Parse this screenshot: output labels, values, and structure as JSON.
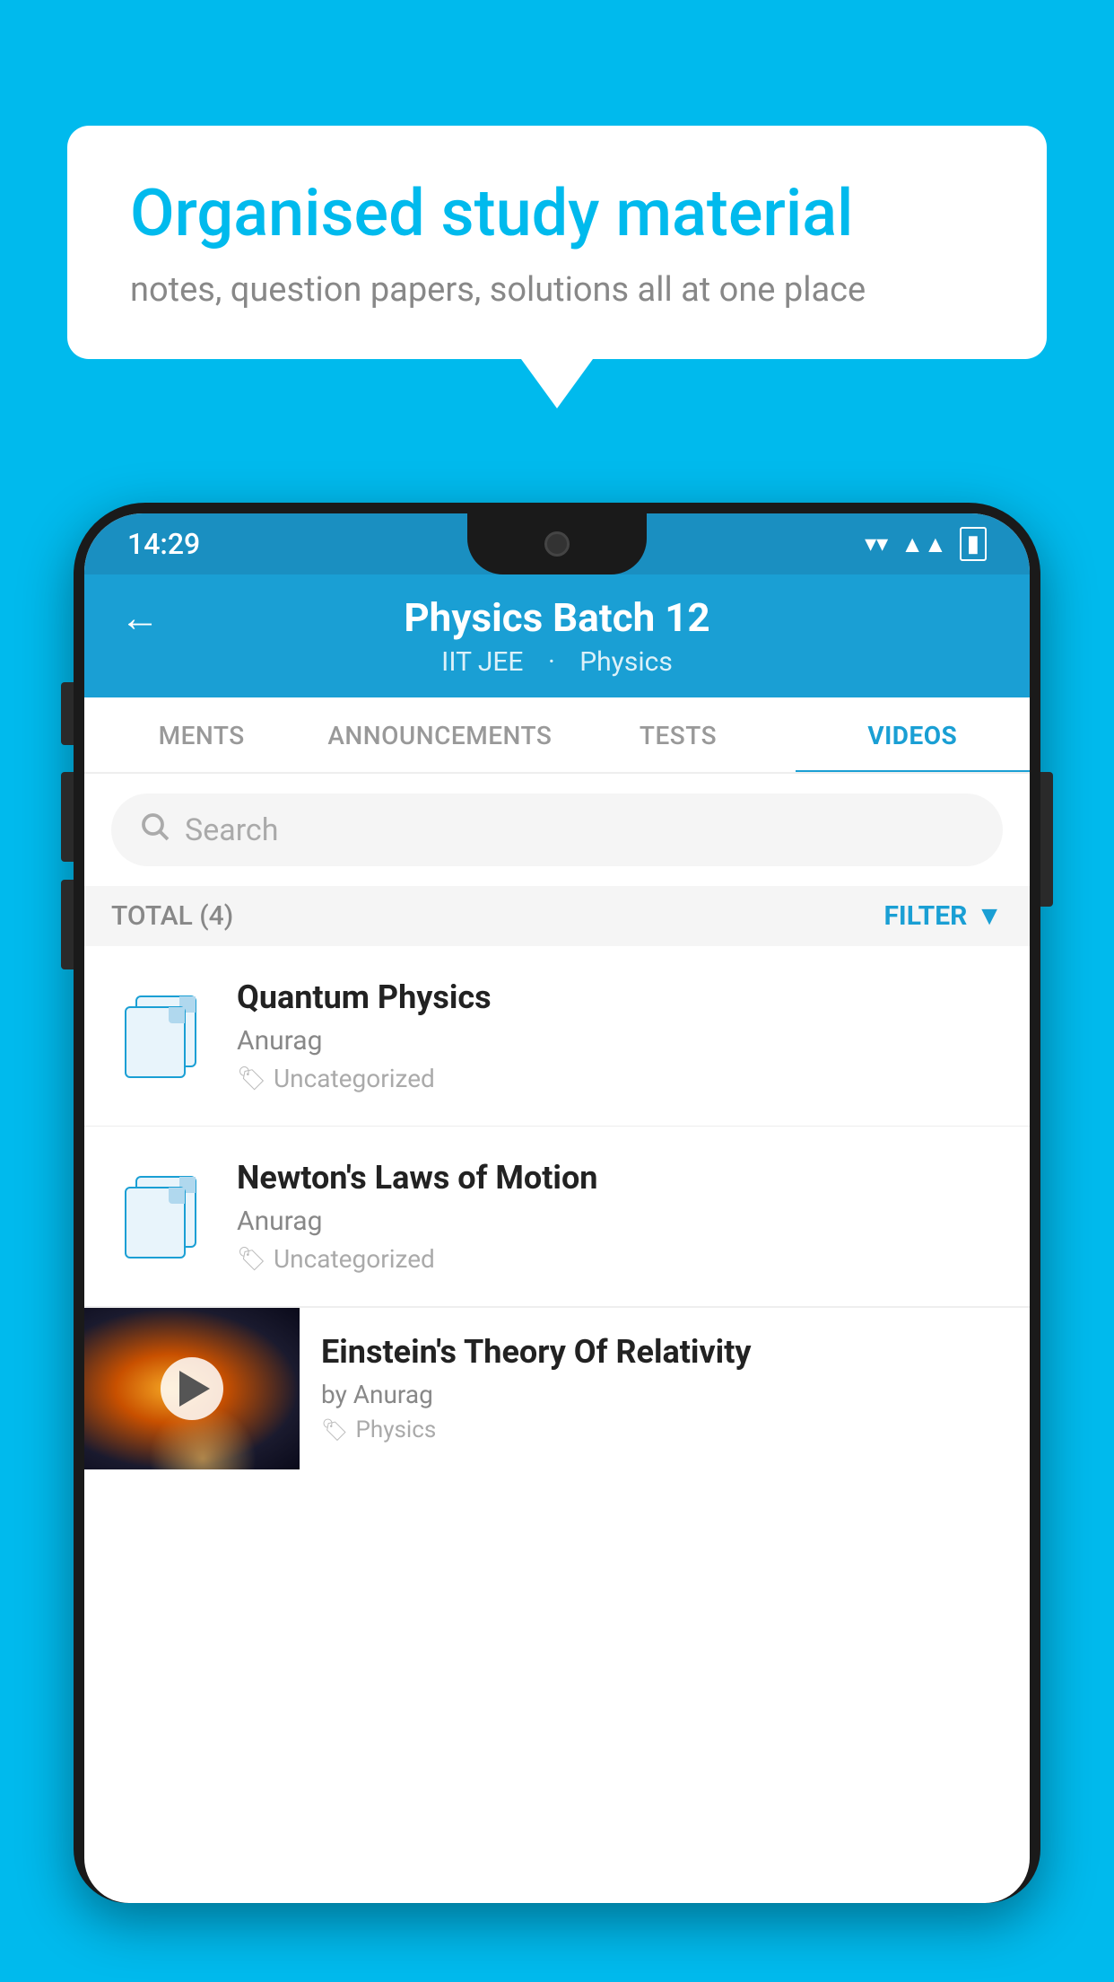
{
  "background_color": "#00BAED",
  "speech_bubble": {
    "title": "Organised study material",
    "subtitle": "notes, question papers, solutions all at one place"
  },
  "status_bar": {
    "time": "14:29",
    "wifi": "▼",
    "signal": "▲",
    "battery": "▮"
  },
  "app_header": {
    "title": "Physics Batch 12",
    "subtitle_part1": "IIT JEE",
    "subtitle_part2": "Physics",
    "back_label": "←"
  },
  "tabs": [
    {
      "label": "MENTS",
      "active": false
    },
    {
      "label": "ANNOUNCEMENTS",
      "active": false
    },
    {
      "label": "TESTS",
      "active": false
    },
    {
      "label": "VIDEOS",
      "active": true
    }
  ],
  "search": {
    "placeholder": "Search"
  },
  "filter_bar": {
    "total_label": "TOTAL (4)",
    "filter_label": "FILTER"
  },
  "videos": [
    {
      "title": "Quantum Physics",
      "author": "Anurag",
      "tag": "Uncategorized",
      "has_thumbnail": false
    },
    {
      "title": "Newton's Laws of Motion",
      "author": "Anurag",
      "tag": "Uncategorized",
      "has_thumbnail": false
    },
    {
      "title": "Einstein's Theory Of Relativity",
      "author": "by Anurag",
      "tag": "Physics",
      "has_thumbnail": true
    }
  ]
}
